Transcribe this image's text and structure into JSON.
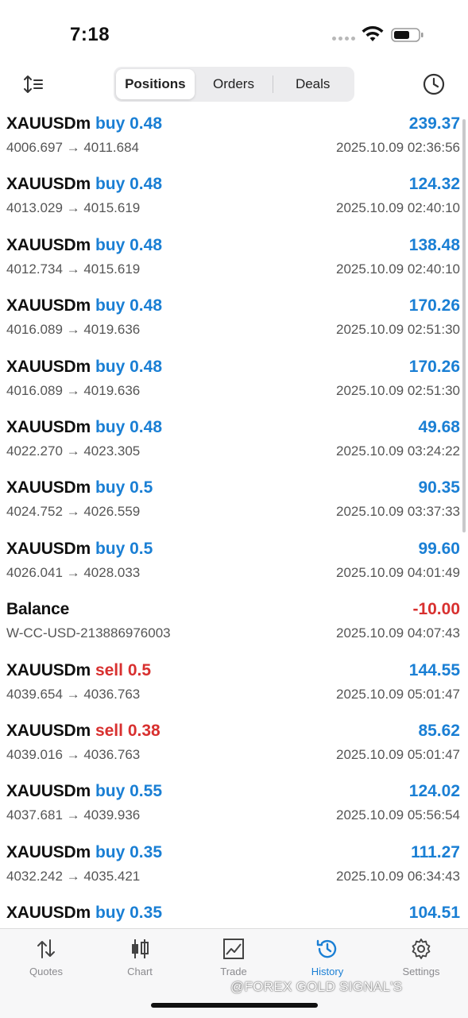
{
  "status_bar": {
    "time": "7:18"
  },
  "toolbar": {
    "tabs": [
      {
        "label": "Positions",
        "active": true
      },
      {
        "label": "Orders",
        "active": false
      },
      {
        "label": "Deals",
        "active": false
      }
    ]
  },
  "colors": {
    "buy": "#1a7fd4",
    "sell": "#d8302f",
    "accent": "#1a7fd4"
  },
  "deals": [
    {
      "symbol": "XAUUSDm",
      "side": "buy",
      "volume": "buy 0.48",
      "profit": "239.37",
      "prices": "4006.697 → 4011.684",
      "time": "2025.10.09 02:36:56"
    },
    {
      "symbol": "XAUUSDm",
      "side": "buy",
      "volume": "buy 0.48",
      "profit": "124.32",
      "prices": "4013.029 → 4015.619",
      "time": "2025.10.09 02:40:10"
    },
    {
      "symbol": "XAUUSDm",
      "side": "buy",
      "volume": "buy 0.48",
      "profit": "138.48",
      "prices": "4012.734 → 4015.619",
      "time": "2025.10.09 02:40:10"
    },
    {
      "symbol": "XAUUSDm",
      "side": "buy",
      "volume": "buy 0.48",
      "profit": "170.26",
      "prices": "4016.089 → 4019.636",
      "time": "2025.10.09 02:51:30"
    },
    {
      "symbol": "XAUUSDm",
      "side": "buy",
      "volume": "buy 0.48",
      "profit": "170.26",
      "prices": "4016.089 → 4019.636",
      "time": "2025.10.09 02:51:30"
    },
    {
      "symbol": "XAUUSDm",
      "side": "buy",
      "volume": "buy 0.48",
      "profit": "49.68",
      "prices": "4022.270 → 4023.305",
      "time": "2025.10.09 03:24:22"
    },
    {
      "symbol": "XAUUSDm",
      "side": "buy",
      "volume": "buy 0.5",
      "profit": "90.35",
      "prices": "4024.752 → 4026.559",
      "time": "2025.10.09 03:37:33"
    },
    {
      "symbol": "XAUUSDm",
      "side": "buy",
      "volume": "buy 0.5",
      "profit": "99.60",
      "prices": "4026.041 → 4028.033",
      "time": "2025.10.09 04:01:49"
    },
    {
      "symbol": "Balance",
      "side": "none",
      "volume": "",
      "profit": "-10.00",
      "prices": "W-CC-USD-213886976003",
      "time": "2025.10.09 04:07:43"
    },
    {
      "symbol": "XAUUSDm",
      "side": "sell",
      "volume": "sell 0.5",
      "profit": "144.55",
      "prices": "4039.654 → 4036.763",
      "time": "2025.10.09 05:01:47"
    },
    {
      "symbol": "XAUUSDm",
      "side": "sell",
      "volume": "sell 0.38",
      "profit": "85.62",
      "prices": "4039.016 → 4036.763",
      "time": "2025.10.09 05:01:47"
    },
    {
      "symbol": "XAUUSDm",
      "side": "buy",
      "volume": "buy 0.55",
      "profit": "124.02",
      "prices": "4037.681 → 4039.936",
      "time": "2025.10.09 05:56:54"
    },
    {
      "symbol": "XAUUSDm",
      "side": "buy",
      "volume": "buy 0.35",
      "profit": "111.27",
      "prices": "4032.242 → 4035.421",
      "time": "2025.10.09 06:34:43"
    },
    {
      "symbol": "XAUUSDm",
      "side": "buy",
      "volume": "buy 0.35",
      "profit": "104.51",
      "prices": "",
      "time": ""
    }
  ],
  "tab_bar": {
    "items": [
      {
        "label": "Quotes",
        "icon": "quotes-arrows-icon",
        "active": false
      },
      {
        "label": "Chart",
        "icon": "candlestick-icon",
        "active": false
      },
      {
        "label": "Trade",
        "icon": "trade-chart-icon",
        "active": false
      },
      {
        "label": "History",
        "icon": "history-clock-icon",
        "active": true
      },
      {
        "label": "Settings",
        "icon": "gear-icon",
        "active": false
      }
    ]
  },
  "watermark": "@FOREX GOLD SIGNAL'S"
}
